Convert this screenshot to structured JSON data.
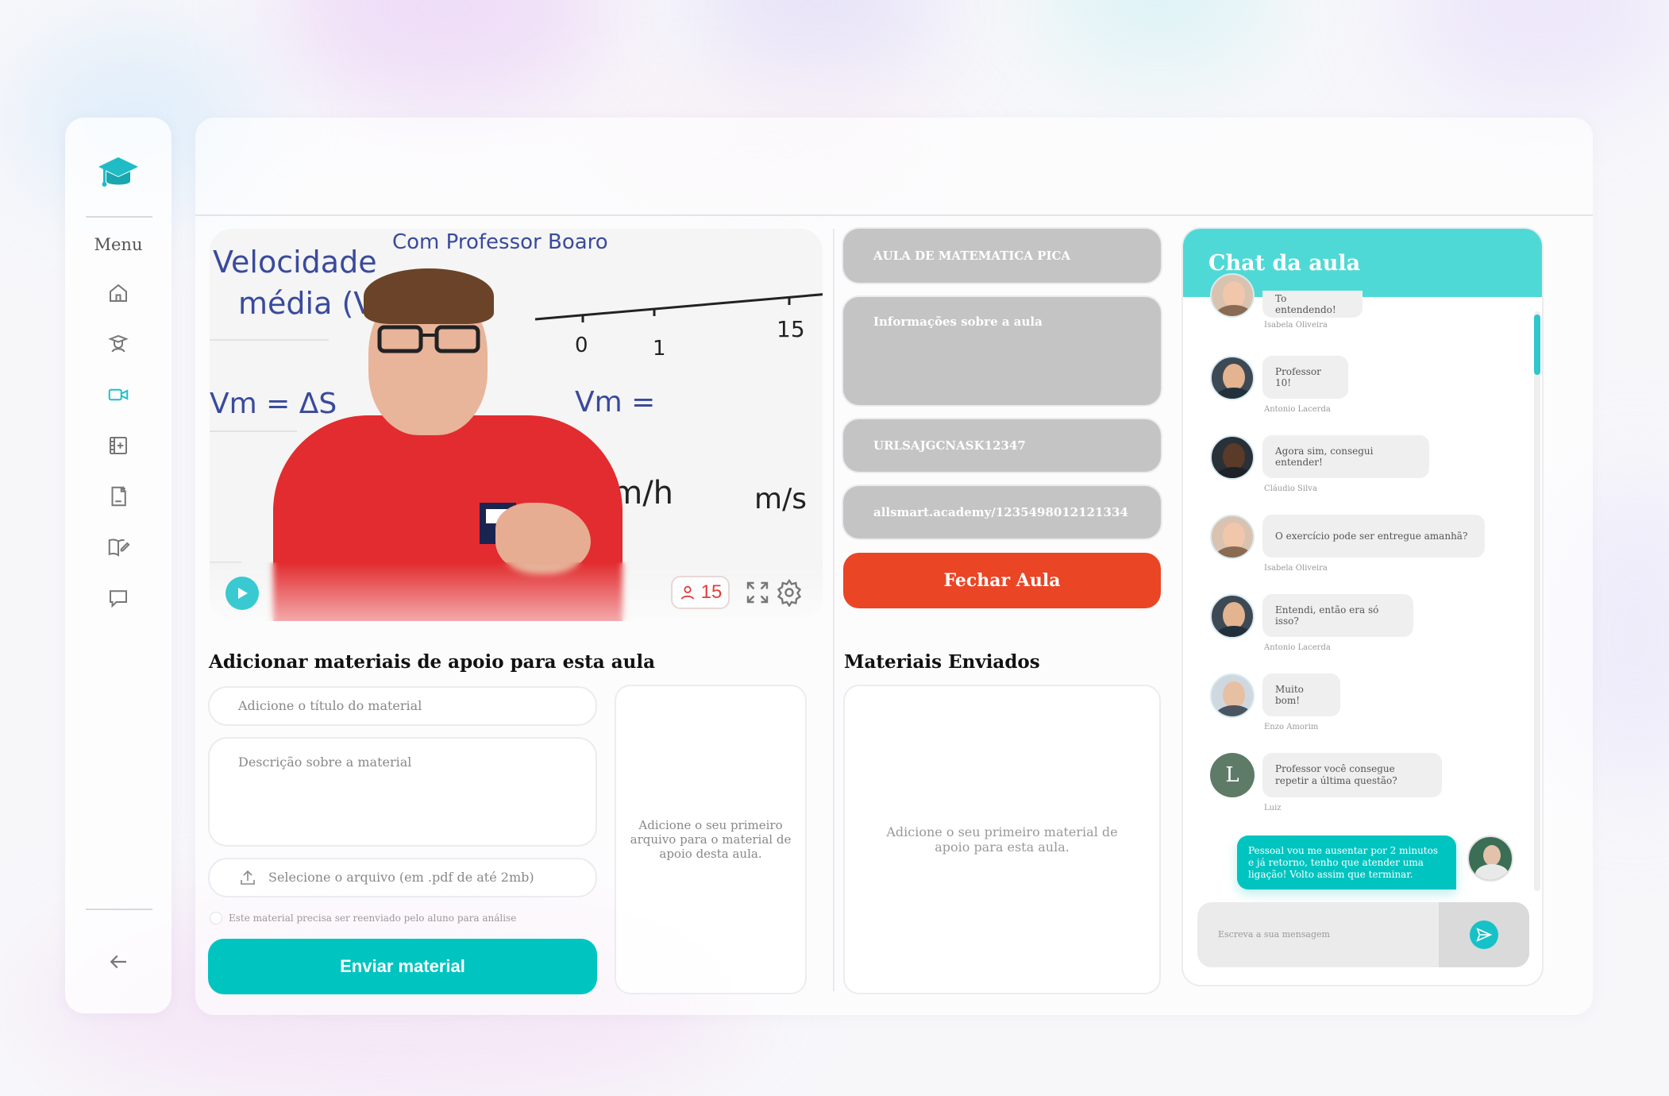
{
  "colors": {
    "accent": "#00c4c0",
    "chat_header": "#4fd9d6",
    "danger": "#ea4525",
    "field_grey": "#c4c4c4",
    "viewer_red": "#e23d3d"
  },
  "sidebar": {
    "menu_label": "Menu",
    "items": [
      {
        "icon": "home-icon",
        "active": false
      },
      {
        "icon": "teacher-icon",
        "active": false
      },
      {
        "icon": "video-camera-icon",
        "active": true
      },
      {
        "icon": "film-add-icon",
        "active": false
      },
      {
        "icon": "document-add-icon",
        "active": false
      },
      {
        "icon": "book-edit-icon",
        "active": false
      },
      {
        "icon": "chat-icon",
        "active": false
      }
    ],
    "back_icon": "arrow-left-icon"
  },
  "video": {
    "board_text_1": "Velocidade",
    "board_text_2": "média (Vm)",
    "board_text_3": "Com Professor Boaro",
    "board_text_4": "Vm = ΔS",
    "board_text_5": "Vm =",
    "board_text_6": "Km/h",
    "board_text_7": "m/s",
    "board_text_8": "0",
    "board_text_9": "1",
    "board_text_10": "15",
    "viewers": "15"
  },
  "support": {
    "title": "Adicionar materiais de apoio para esta aula",
    "title_placeholder": "Adicione o título do material",
    "description_placeholder": "Descrição sobre a material",
    "file_label": "Selecione o arquivo (em .pdf de até 2mb)",
    "checkbox_label": "Este material precisa ser reenviado pelo aluno para análise",
    "submit_label": "Enviar material",
    "empty_upload": "Adicione o seu primeiro arquivo para o material de apoio desta aula."
  },
  "lesson": {
    "title": "AULA DE MATEMATICA PICA",
    "info_placeholder": "Informações sobre a aula",
    "code": "URLSAJGCNASK12347",
    "link": "allsmart.academy/1235498012121334",
    "close_label": "Fechar Aula"
  },
  "sent": {
    "title": "Materiais Enviados",
    "empty": "Adicione o seu primeiro material de apoio para esta aula."
  },
  "chat": {
    "title": "Chat da aula",
    "messages": [
      {
        "text": "To entendendo!",
        "sender": "Isabela Oliveira"
      },
      {
        "text": "Professor 10!",
        "sender": "Antonio Lacerda"
      },
      {
        "text": "Agora sim, consegui entender!",
        "sender": "Cláudio Silva"
      },
      {
        "text": "O exercício pode ser entregue amanhã?",
        "sender": "Isabela Oliveira"
      },
      {
        "text": "Entendi,  então era só isso?",
        "sender": "Antonio Lacerda"
      },
      {
        "text": "Muito bom!",
        "sender": "Enzo Amorim"
      },
      {
        "text": "Professor você consegue repetir a última questão?",
        "sender": "Luiz",
        "initial": "L"
      }
    ],
    "own_message": "Pessoal vou me ausentar por 2 minutos e já retorno, tenho que atender uma ligação! Volto assim que terminar.",
    "input_placeholder": "Escreva a sua mensagem"
  }
}
